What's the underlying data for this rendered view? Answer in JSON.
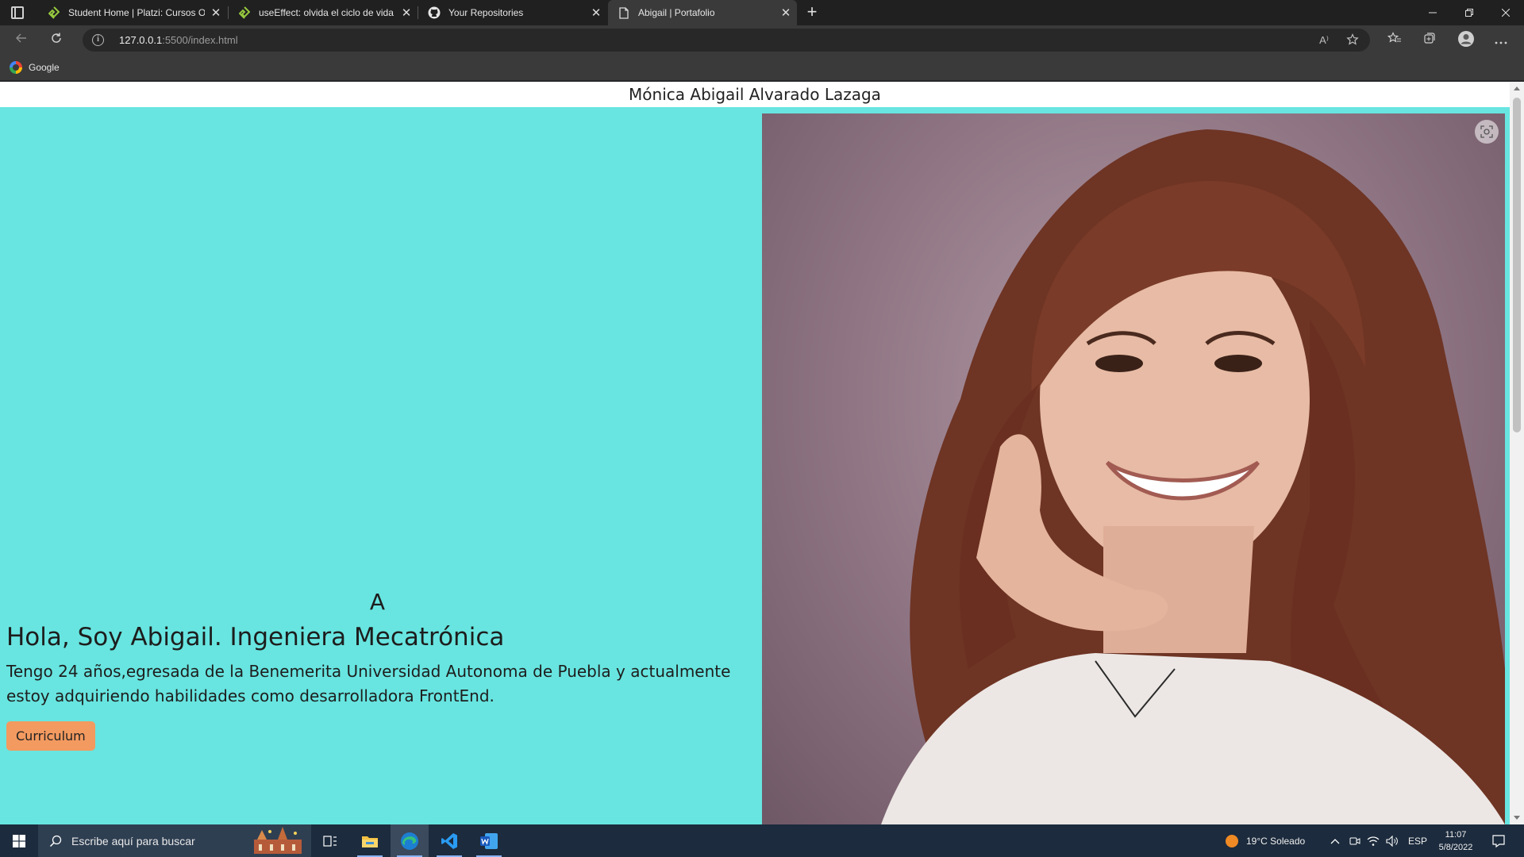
{
  "browser": {
    "tabs": [
      {
        "title": "Student Home | Platzi: Cursos Or",
        "icon": "platzi-icon",
        "active": false
      },
      {
        "title": "useEffect: olvida el ciclo de vida",
        "icon": "platzi-icon",
        "active": false
      },
      {
        "title": "Your Repositories",
        "icon": "github-icon",
        "active": false
      },
      {
        "title": "Abigail | Portafolio",
        "icon": "page-icon",
        "active": true
      }
    ],
    "close_glyph": "✕",
    "new_tab_glyph": "+",
    "address": {
      "host": "127.0.0.1",
      "path": ":5500/index.html"
    },
    "bookmarks": [
      {
        "label": "Google",
        "icon": "google-icon"
      }
    ],
    "read_aloud_glyph": "A⁾"
  },
  "page": {
    "header_title": "Mónica Abigail Alvarado Lazaga",
    "hero_letter": "A",
    "hero_title": "Hola, Soy Abigail. Ingeniera Mecatrónica",
    "hero_description": "Tengo 24 años,egresada de la Benemerita Universidad Autonoma de Puebla y actualmente estoy adquiriendo habilidades como desarrolladora FrontEnd.",
    "cv_button": "Curriculum",
    "hero_background": "#68e5e0",
    "button_color": "#f39a60",
    "photo_subject": "portrait photo of smiling woman with long brown hair"
  },
  "taskbar": {
    "search_placeholder": "Escribe aquí para buscar",
    "weather": "19°C  Soleado",
    "language": "ESP",
    "time": "11:07",
    "date": "5/8/2022"
  }
}
